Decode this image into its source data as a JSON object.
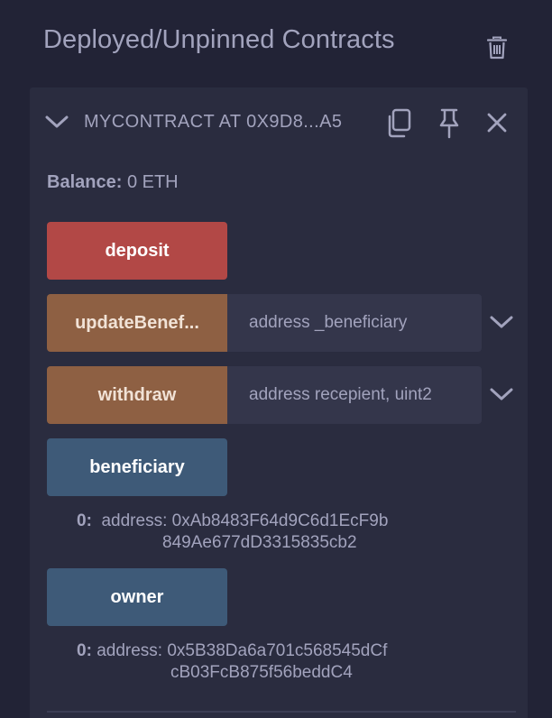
{
  "header": {
    "title": "Deployed/Unpinned Contracts",
    "trash_icon": "trash-icon"
  },
  "contract": {
    "title": "MYCONTRACT AT 0X9D8...A5",
    "icons": [
      "chevron-down-icon",
      "copy-icon",
      "pin-icon",
      "close-icon"
    ],
    "balance_label": "Balance:",
    "balance_value": "0 ETH"
  },
  "functions": [
    {
      "label": "deposit",
      "kind": "payable",
      "color": "#b24846"
    },
    {
      "label": "updateBenef...",
      "kind": "nonpayable",
      "color": "#8e6043",
      "placeholder": "address _beneficiary"
    },
    {
      "label": "withdraw",
      "kind": "nonpayable",
      "color": "#8e6043",
      "placeholder": "address recepient, uint2"
    },
    {
      "label": "beneficiary",
      "kind": "view",
      "color": "#3e5a78"
    },
    {
      "label": "owner",
      "kind": "view",
      "color": "#3e5a78"
    }
  ],
  "results": {
    "beneficiary": {
      "index": "0:",
      "line1": "address: 0xAb8483F64d9C6d1EcF9b",
      "line2": "849Ae677dD3315835cb2"
    },
    "owner": {
      "index": "0:",
      "line1": "address: 0x5B38Da6a701c568545dCf",
      "line2": "cB03FcB875f56beddC4"
    }
  }
}
